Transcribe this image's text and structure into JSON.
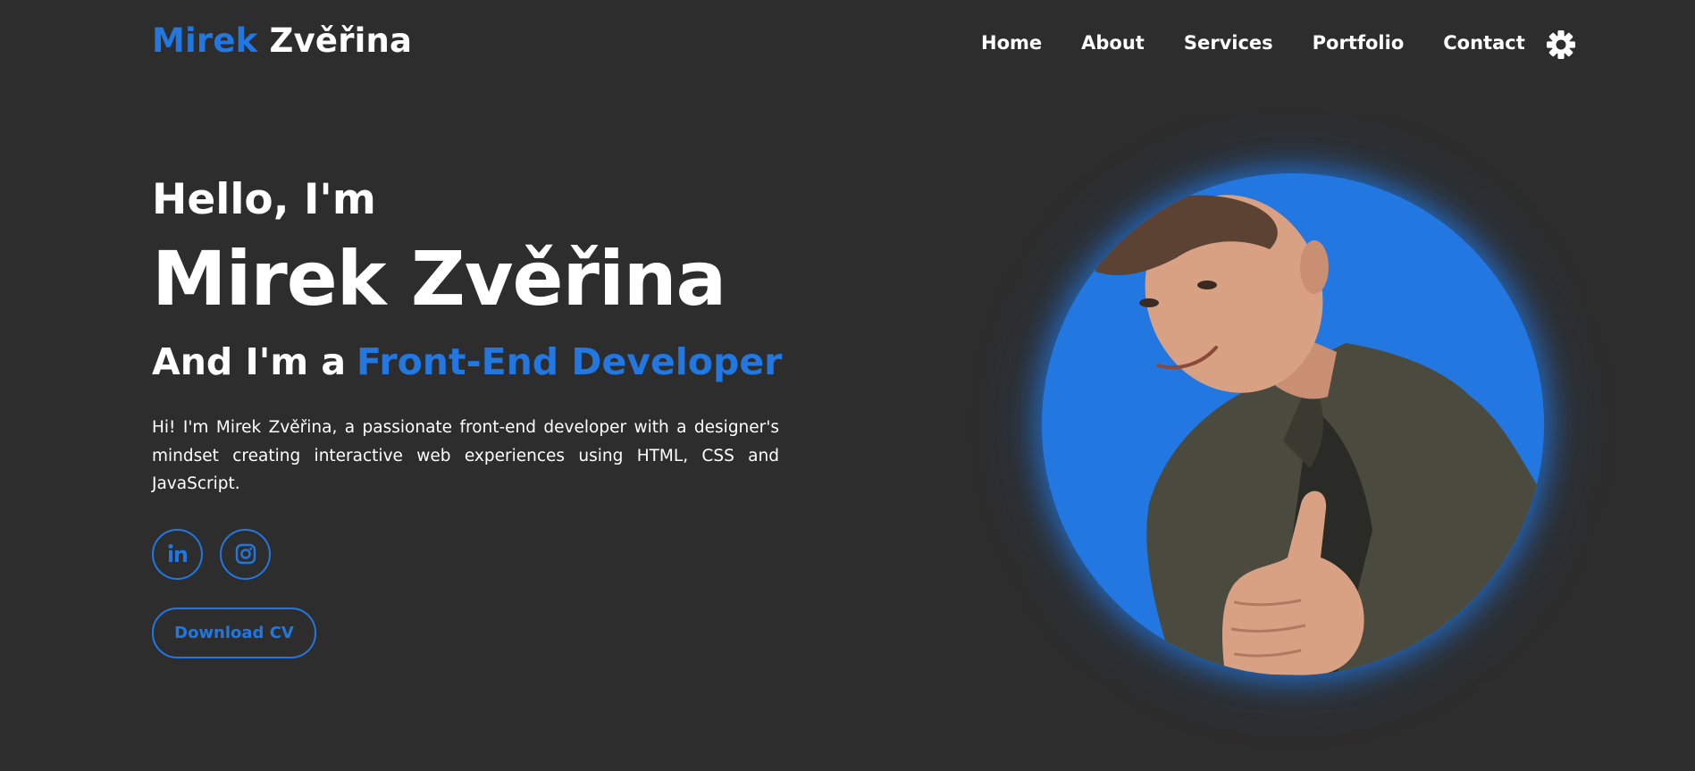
{
  "header": {
    "logo_first": "Mirek",
    "logo_last": "Zvěřina",
    "nav": [
      "Home",
      "About",
      "Services",
      "Portfolio",
      "Contact"
    ],
    "theme_icon": "sun-gear-icon"
  },
  "hero": {
    "greeting": "Hello, I'm",
    "name": "Mirek Zvěřina",
    "role_prefix": "And I'm a",
    "role_highlight": "Front-End Developer",
    "bio": "Hi! I'm Mirek Zvěřina, a passionate front-end developer with a designer's mindset creating interactive web experiences using HTML, CSS and JavaScript.",
    "socials": [
      {
        "icon": "linkedin-icon",
        "label": "in"
      },
      {
        "icon": "instagram-icon"
      }
    ],
    "cv_button": "Download CV"
  },
  "colors": {
    "background": "#2d2d2d",
    "accent": "#2277e1",
    "text": "#ffffff"
  }
}
